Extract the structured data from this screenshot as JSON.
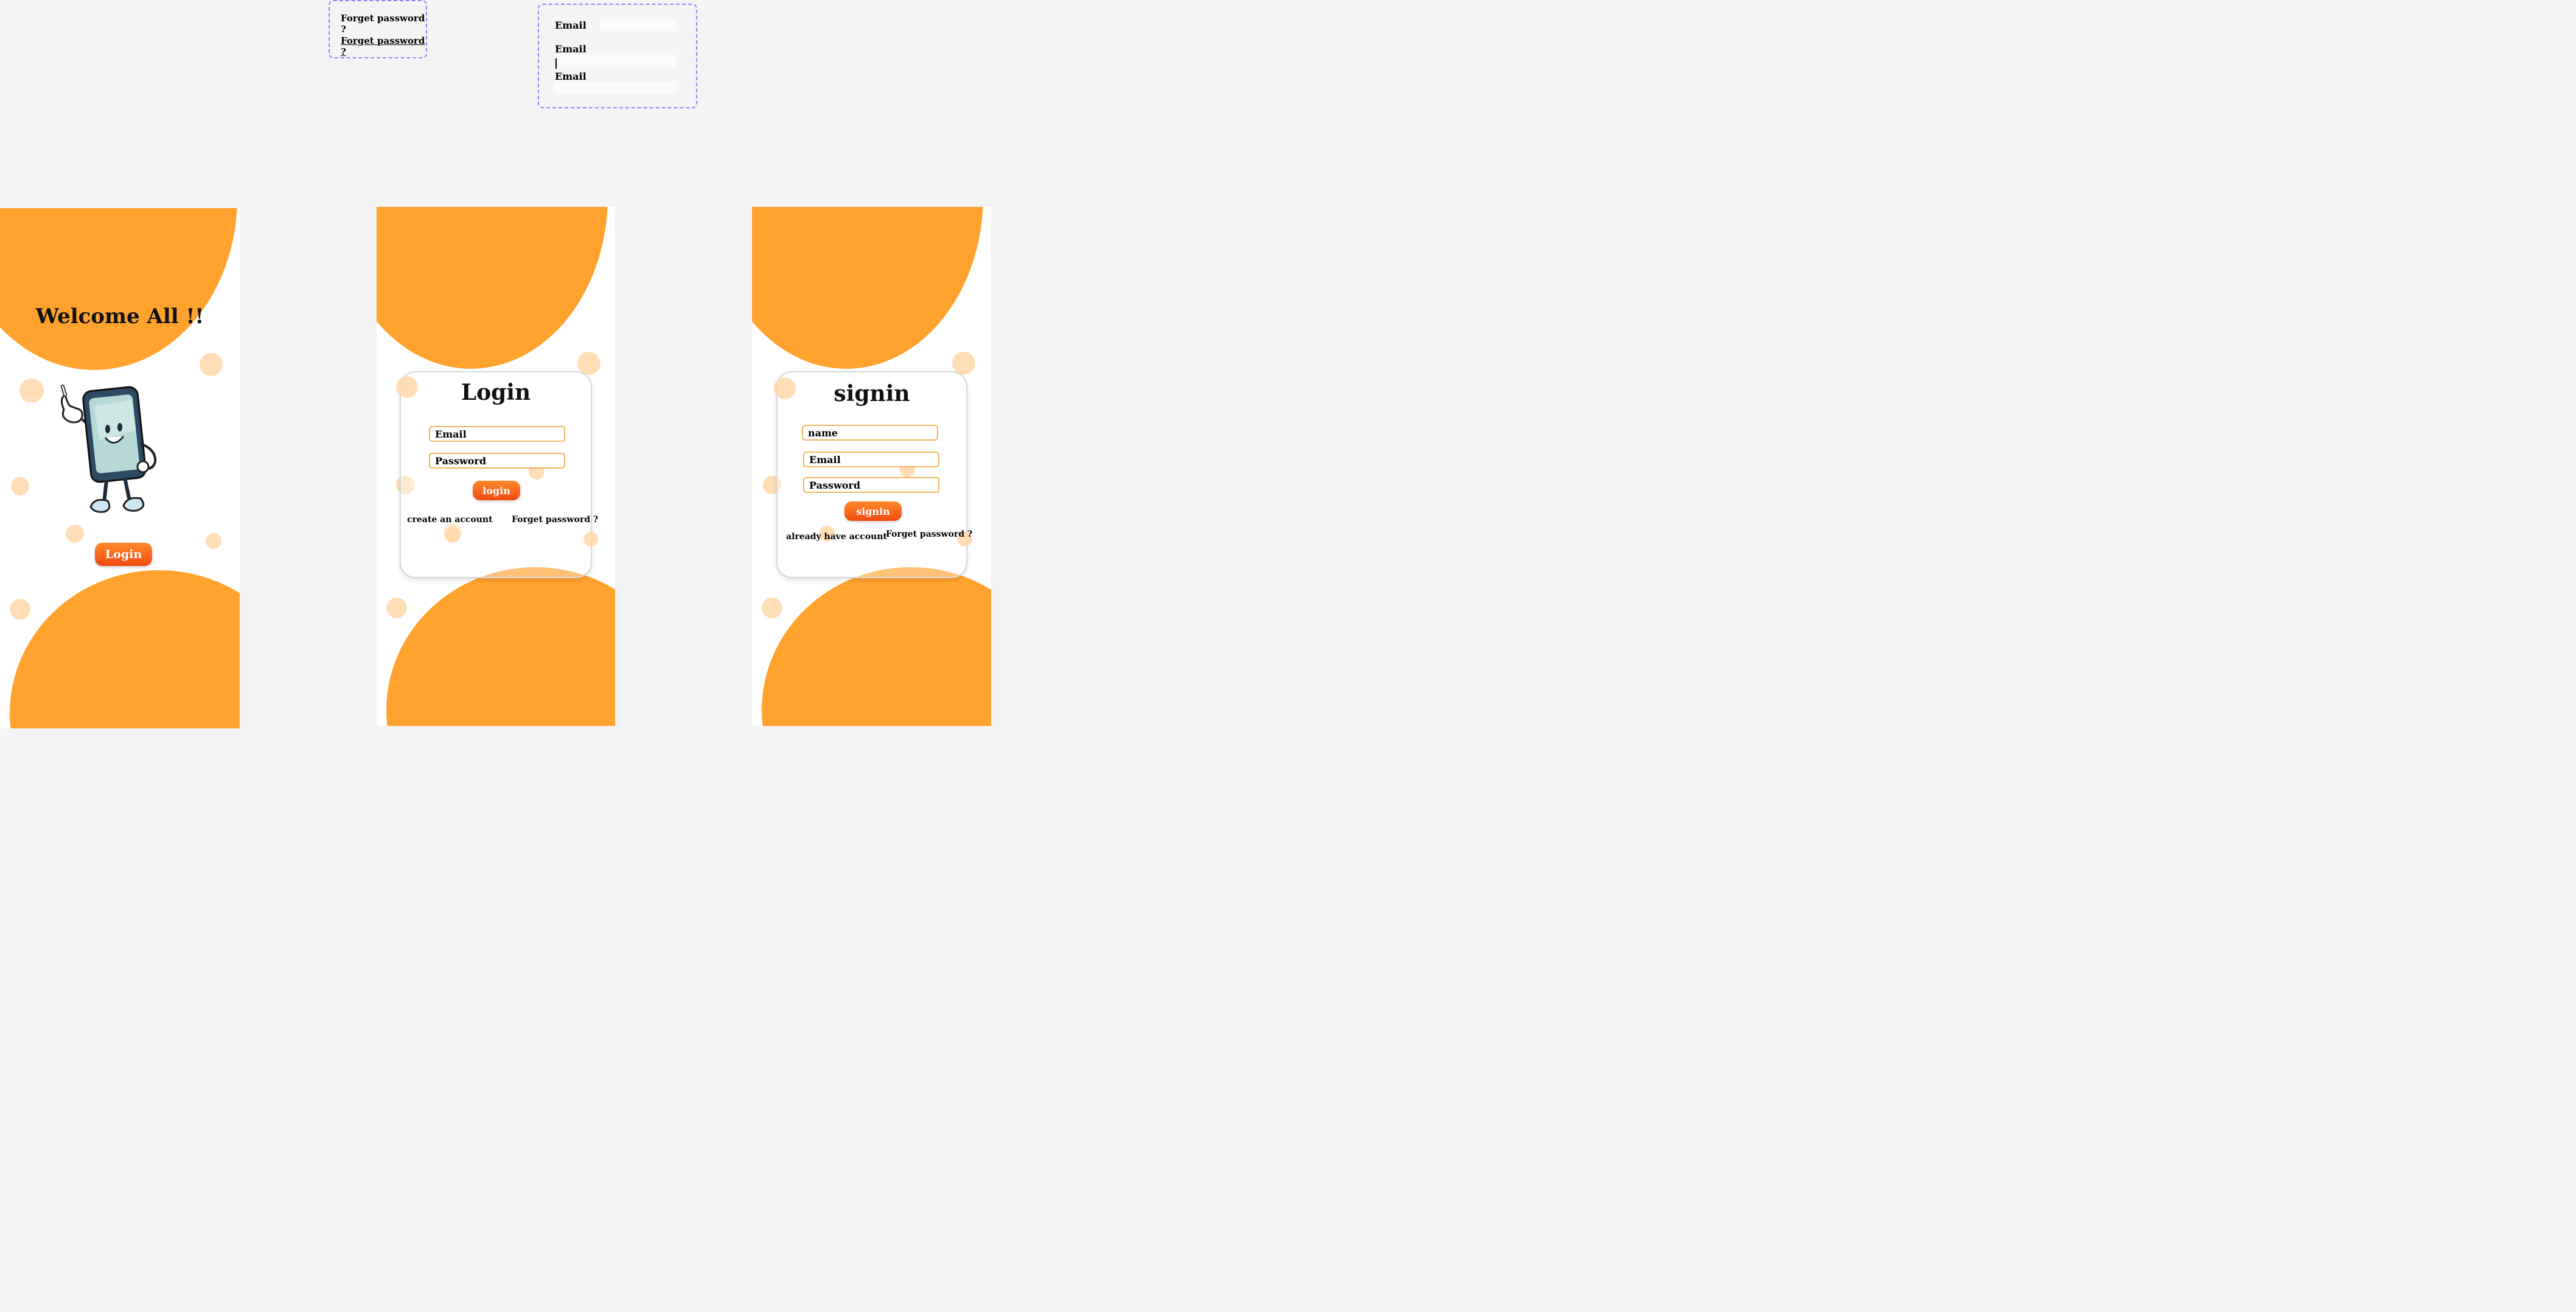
{
  "component_variants": {
    "forget_password_default": "Forget password ?",
    "forget_password_hover": "Forget password ?",
    "email_label_1": "Email",
    "email_label_2": "Email",
    "email_label_3": "Email"
  },
  "welcome_screen": {
    "heading": "Welcome All !!",
    "mascot_icon": "phone-mascot-pointing",
    "login_button": "Login"
  },
  "login_screen": {
    "heading": "Login",
    "email_placeholder": "Email",
    "password_placeholder": "Password",
    "submit_button": "login",
    "create_account_link": "create an account",
    "forgot_password_link": "Forget password ?"
  },
  "signin_screen": {
    "heading": "signin",
    "name_placeholder": "name",
    "email_placeholder": "Email",
    "password_placeholder": "Password",
    "submit_button": "signin",
    "have_account_link": "already have account",
    "forgot_password_link": "Forget password ?"
  },
  "colors": {
    "accent_orange": "#ffa22e",
    "button_gradient_top": "#ff8a2a",
    "button_gradient_bottom": "#f24a10",
    "variant_border": "#9e80f5",
    "canvas_background": "#f4f4f4"
  }
}
